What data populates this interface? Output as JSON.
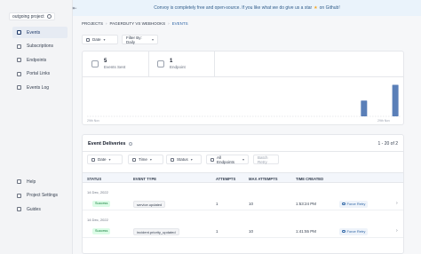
{
  "sidebar": {
    "project": "outgoing project",
    "nav": [
      {
        "label": "Events"
      },
      {
        "label": "Subscriptions"
      },
      {
        "label": "Endpoints"
      },
      {
        "label": "Portal Links"
      },
      {
        "label": "Events Log"
      }
    ],
    "bottom": [
      {
        "label": "Help"
      },
      {
        "label": "Project Settings"
      },
      {
        "label": "Guides"
      }
    ]
  },
  "banner": {
    "text_before": "Convoy is completely free and open-source. If you like what we do give us a star",
    "star": "★",
    "text_after": "on Github!"
  },
  "breadcrumb": {
    "items": [
      "PROJECTS",
      "PAGERDUTY VS WEBHOOKS",
      "EVENTS"
    ],
    "sep": "›"
  },
  "filters": {
    "date_label": "Date",
    "filter_by": "Filter By: Daily"
  },
  "stats": {
    "events_sent": {
      "value": "5",
      "label": "Events Sent"
    },
    "endpoint": {
      "value": "1",
      "label": "Endpoint"
    }
  },
  "chart_data": {
    "type": "bar",
    "categories": [
      "",
      "",
      "",
      "",
      "",
      "",
      "",
      "",
      "",
      "",
      "",
      "",
      "",
      "",
      "",
      "",
      "",
      "",
      "",
      "",
      "",
      "",
      "",
      "",
      "",
      "",
      "",
      "",
      "",
      ""
    ],
    "values": [
      0,
      0,
      0,
      0,
      0,
      0,
      0,
      0,
      0,
      0,
      0,
      0,
      0,
      0,
      0,
      0,
      0,
      0,
      0,
      0,
      0,
      0,
      0,
      0,
      0,
      0,
      2,
      0,
      0,
      4
    ],
    "x_tick_labels": [
      "29th Nov",
      "",
      "29th Nov"
    ],
    "ylim": [
      0,
      4.5
    ],
    "grid": false,
    "bar_color": "#5a7fb8"
  },
  "deliveries": {
    "title": "Event Deliveries",
    "pagination": "1 - 20 of 2",
    "filters": {
      "date": "Date",
      "time": "Time",
      "status": "Status",
      "endpoints": "All Endpoints",
      "batch_retry": "Batch Retry"
    },
    "columns": [
      "STATUS",
      "EVENT TYPE",
      "ATTEMPTS",
      "MAX ATTEMPTS",
      "TIME CREATED"
    ],
    "groups": [
      {
        "date": "14 Dec, 2022",
        "row": {
          "status": "Success",
          "event_type": "service.updated",
          "attempts": "1",
          "max_attempts": "10",
          "time": "1:53:24 PM",
          "action": "Force Retry"
        }
      },
      {
        "date": "14 Dec, 2022",
        "row": {
          "status": "Success",
          "event_type": "incident.priority_updated",
          "attempts": "1",
          "max_attempts": "10",
          "time": "1:41:55 PM",
          "action": "Force Retry"
        }
      }
    ]
  }
}
